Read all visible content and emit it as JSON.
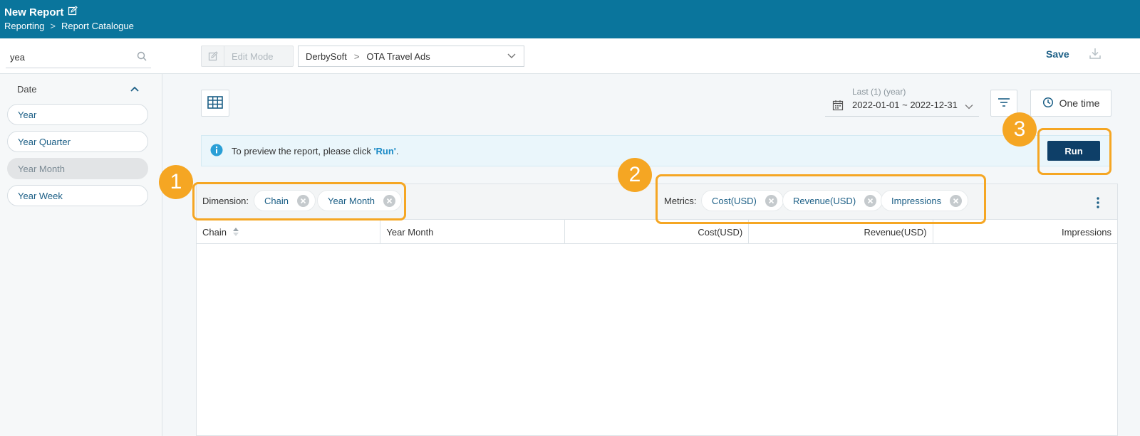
{
  "header": {
    "title": "New Report",
    "breadcrumb": [
      "Reporting",
      ">",
      "Report Catalogue"
    ]
  },
  "sidebar": {
    "search_value": "yea",
    "group_label": "Date",
    "items": [
      {
        "label": "Year",
        "active": false
      },
      {
        "label": "Year Quarter",
        "active": false
      },
      {
        "label": "Year Month",
        "active": true
      },
      {
        "label": "Year Week",
        "active": false
      }
    ]
  },
  "toolbar": {
    "edit_mode_label": "Edit Mode",
    "source_parent": "DerbySoft",
    "source_sep": ">",
    "source_child": "OTA Travel Ads",
    "save_label": "Save"
  },
  "controls": {
    "date_label": "Last (1) (year)",
    "date_value": "2022-01-01 ~ 2022-12-31",
    "schedule_label": "One time"
  },
  "info": {
    "text": "To preview the report, please click ",
    "highlight": "'Run'",
    "suffix": "."
  },
  "run_label": "Run",
  "dimensions": {
    "label": "Dimension:",
    "chips": [
      "Chain",
      "Year Month"
    ]
  },
  "metrics": {
    "label": "Metrics:",
    "chips": [
      "Cost(USD)",
      "Revenue(USD)",
      "Impressions"
    ]
  },
  "table": {
    "columns": [
      "Chain",
      "Year Month",
      "Cost(USD)",
      "Revenue(USD)",
      "Impressions"
    ]
  },
  "callouts": [
    "1",
    "2",
    "3"
  ],
  "colors": {
    "header_bg": "#0a759c",
    "accent_orange": "#f5a623",
    "run_button": "#0e3f68",
    "link_blue": "#1c5f86"
  }
}
